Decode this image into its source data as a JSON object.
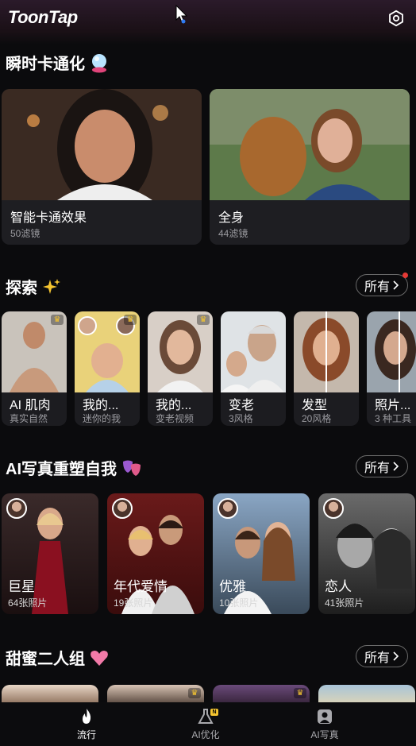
{
  "app": {
    "title": "ToonTap"
  },
  "sections": {
    "instant": {
      "title": "瞬时卡通化"
    },
    "explore": {
      "title": "探索",
      "all_label": "所有"
    },
    "portrait": {
      "title": "AI写真重塑自我",
      "all_label": "所有"
    },
    "duo": {
      "title": "甜蜜二人组",
      "all_label": "所有"
    }
  },
  "big_cards": [
    {
      "title": "智能卡通效果",
      "sub": "50滤镜"
    },
    {
      "title": "全身",
      "sub": "44滤镜"
    }
  ],
  "explore_cards": [
    {
      "title": "AI 肌肉",
      "sub": "真实自然"
    },
    {
      "title": "我的...",
      "sub": "迷你的我"
    },
    {
      "title": "我的...",
      "sub": "变老视频"
    },
    {
      "title": "变老",
      "sub": "3风格"
    },
    {
      "title": "发型",
      "sub": "20风格"
    },
    {
      "title": "照片...",
      "sub": "3 种工具"
    }
  ],
  "portrait_cards": [
    {
      "title": "巨星",
      "sub": "64张照片"
    },
    {
      "title": "年代爱情",
      "sub": "19张照片"
    },
    {
      "title": "优雅",
      "sub": "10张照片"
    },
    {
      "title": "恋人",
      "sub": "41张照片"
    }
  ],
  "nav": [
    {
      "label": "流行",
      "active": true
    },
    {
      "label": "AI优化",
      "badge": "N"
    },
    {
      "label": "AI写真"
    }
  ],
  "colors": {
    "background": "#0b0b0d",
    "card": "#1e1e22",
    "accent_gold": "#f4c430",
    "notify": "#e53935"
  }
}
